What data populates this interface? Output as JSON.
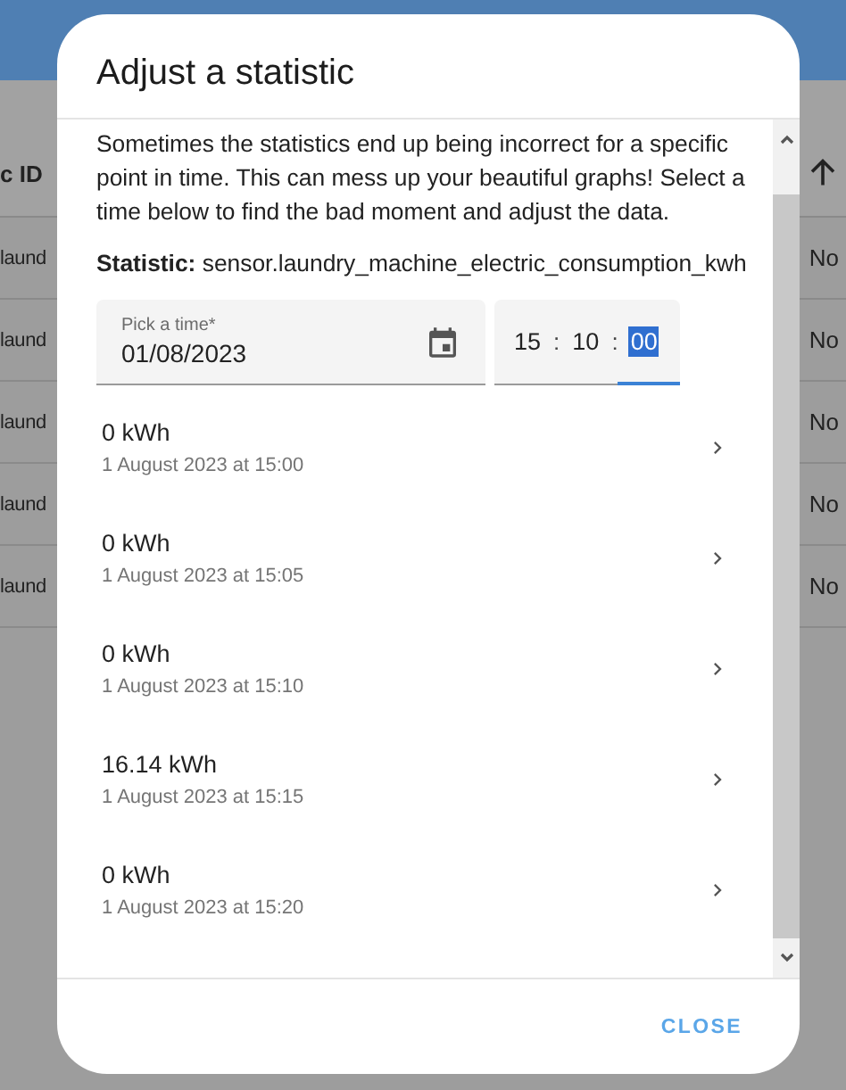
{
  "table": {
    "header": "c ID",
    "rows": [
      {
        "id": "laund",
        "value": "No"
      },
      {
        "id": "laund",
        "value": "No"
      },
      {
        "id": "laund",
        "value": "No"
      },
      {
        "id": "laund",
        "value": "No"
      },
      {
        "id": "laund",
        "value": "No"
      }
    ]
  },
  "dialog": {
    "title": "Adjust a statistic",
    "description": "Sometimes the statistics end up being incorrect for a specific point in time. This can mess up your beautiful graphs! Select a time below to find the bad moment and adjust the data.",
    "statistic": "**Statistic:** sensor.laundry_machine_electric_consumption_kwh",
    "date_field": {
      "label": "Pick a time*",
      "value": "01/08/2023"
    },
    "time_field": {
      "separator": ":",
      "segments": [
        {
          "value": "15",
          "selected": false
        },
        {
          "value": "10",
          "selected": false
        },
        {
          "value": "00",
          "selected": true
        }
      ]
    },
    "entries": [
      {
        "value": "0 kWh",
        "time": "1 August 2023 at 15:00"
      },
      {
        "value": "0 kWh",
        "time": "1 August 2023 at 15:05"
      },
      {
        "value": "0 kWh",
        "time": "1 August 2023 at 15:10"
      },
      {
        "value": "16.14 kWh",
        "time": "1 August 2023 at 15:15"
      },
      {
        "value": "0 kWh",
        "time": "1 August 2023 at 15:20"
      }
    ],
    "buttons": [
      "CLOSE"
    ]
  }
}
